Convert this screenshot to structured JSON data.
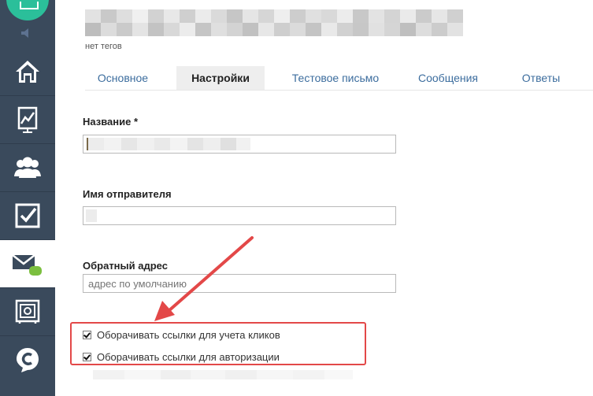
{
  "app": {
    "tags_text": "нет тегов"
  },
  "sidebar": {
    "items": [
      {
        "icon": "home-icon"
      },
      {
        "icon": "chart-icon"
      },
      {
        "icon": "users-icon"
      },
      {
        "icon": "checkbox-icon"
      },
      {
        "icon": "mail-icon",
        "active": true
      },
      {
        "icon": "safe-icon"
      },
      {
        "icon": "chat-icon"
      }
    ]
  },
  "tabs": [
    {
      "label": "Основное"
    },
    {
      "label": "Настройки",
      "active": true
    },
    {
      "label": "Тестовое письмо"
    },
    {
      "label": "Сообщения"
    },
    {
      "label": "Ответы"
    }
  ],
  "form": {
    "name_label": "Название *",
    "sender_label": "Имя отправителя",
    "reply_label": "Обратный адрес",
    "reply_placeholder": "адрес по умолчанию",
    "wrap_clicks_label": "Оборачивать ссылки для учета кликов",
    "wrap_auth_label": "Оборачивать ссылки для авторизации",
    "wrap_clicks_checked": true,
    "wrap_auth_checked": true
  },
  "colors": {
    "sidebar": "#3a4a5c",
    "accent_green": "#2bbf9a",
    "tab_link": "#3c6d9e",
    "highlight_red": "#e34848"
  }
}
